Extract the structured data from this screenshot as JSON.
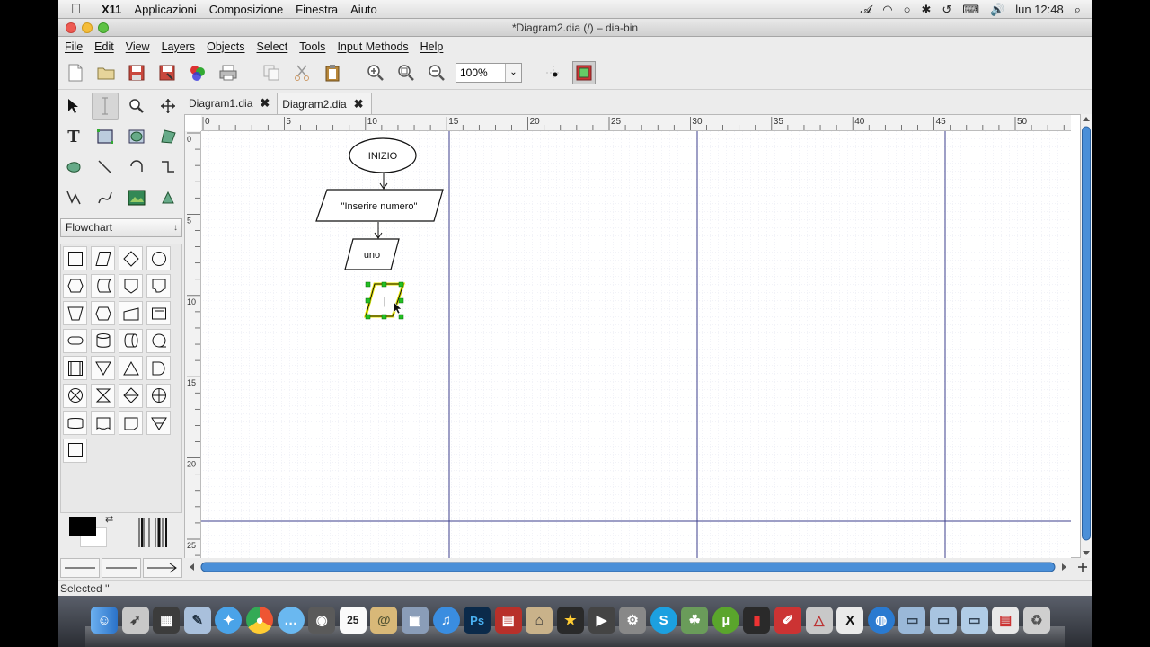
{
  "mac_menubar": {
    "apple": "",
    "app": "X11",
    "items": [
      "Applicazioni",
      "Composizione",
      "Finestra",
      "Aiuto"
    ],
    "clock": "lun 12:48"
  },
  "window": {
    "title": "*Diagram2.dia (/) – dia-bin"
  },
  "menu": [
    "File",
    "Edit",
    "View",
    "Layers",
    "Objects",
    "Select",
    "Tools",
    "Input Methods",
    "Help"
  ],
  "toolbar": {
    "zoom_value": "100%"
  },
  "toolbox": {
    "sheet": "Flowchart"
  },
  "tabs": [
    {
      "label": "Diagram1.dia",
      "active": false
    },
    {
      "label": "Diagram2.dia",
      "active": true
    }
  ],
  "ruler": {
    "h_ticks": [
      "0",
      "5",
      "10",
      "15",
      "20",
      "25",
      "30",
      "35",
      "40",
      "45",
      "50"
    ],
    "v_ticks": [
      "0",
      "5",
      "10",
      "15",
      "20",
      "25"
    ]
  },
  "diagram": {
    "start_label": "INIZIO",
    "input_label": "\"Inserire numero\"",
    "var_label": "uno",
    "edit_text": "|"
  },
  "status": {
    "text": "Selected ''"
  },
  "colors": {
    "selection": "#f4f400",
    "handle": "#22c022",
    "page_break": "#3c3f8c",
    "grid": "#dfe3ef",
    "scroll_thumb": "#4a8fd8"
  }
}
